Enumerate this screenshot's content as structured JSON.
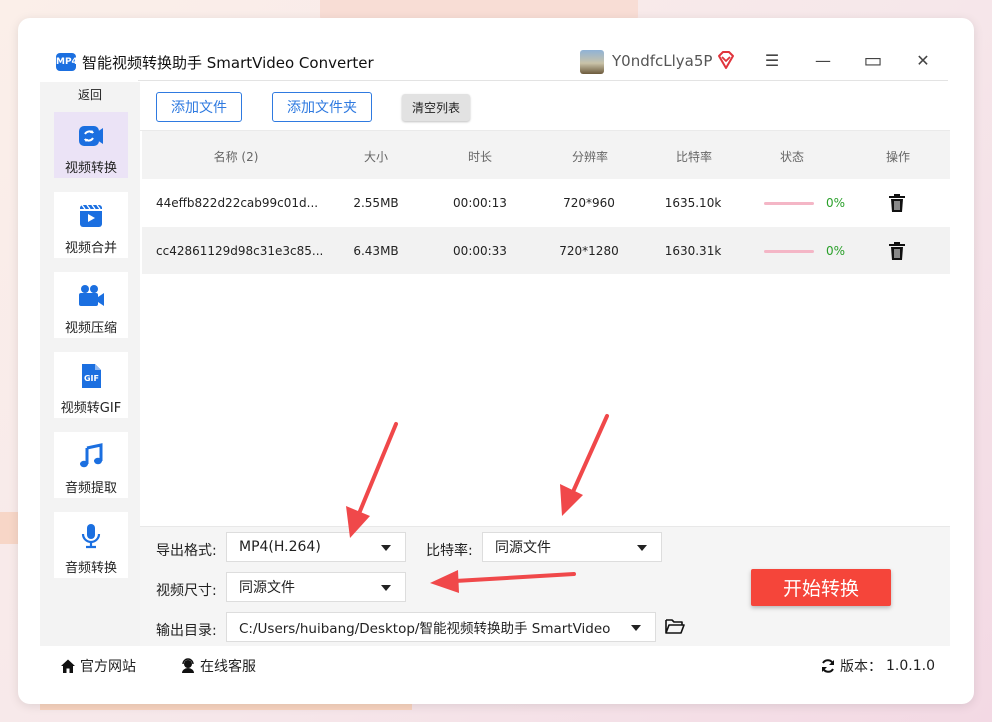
{
  "window": {
    "title": "智能视频转换助手 SmartVideo Converter",
    "logo_text": "MP4",
    "username": "Y0ndfcLlya5P",
    "controls": {
      "menu": "☰",
      "minimize": "—",
      "maximize": "▭",
      "close": "✕"
    }
  },
  "sidebar": {
    "back_label": "返回",
    "items": [
      {
        "label": "视频转换",
        "icon": "video-convert-icon",
        "active": true
      },
      {
        "label": "视频合并",
        "icon": "video-merge-icon",
        "active": false
      },
      {
        "label": "视频压缩",
        "icon": "video-compress-icon",
        "active": false
      },
      {
        "label": "视频转GIF",
        "icon": "gif-icon",
        "active": false
      },
      {
        "label": "音频提取",
        "icon": "music-note-icon",
        "active": false
      },
      {
        "label": "音频转换",
        "icon": "microphone-icon",
        "active": false
      }
    ]
  },
  "toolbar": {
    "add_file": "添加文件",
    "add_folder": "添加文件夹",
    "clear_list": "清空列表"
  },
  "table": {
    "headers": [
      "名称 (2)",
      "大小",
      "时长",
      "分辨率",
      "比特率",
      "状态",
      "操作"
    ],
    "rows": [
      {
        "name": "44effb822d22cab99c01d...",
        "size": "2.55MB",
        "duration": "00:00:13",
        "resolution": "720*960",
        "bitrate": "1635.10k",
        "progress": "0%"
      },
      {
        "name": "cc42861129d98c31e3c85...",
        "size": "6.43MB",
        "duration": "00:00:33",
        "resolution": "720*1280",
        "bitrate": "1630.31k",
        "progress": "0%"
      }
    ]
  },
  "options": {
    "format_label": "导出格式:",
    "format_value": "MP4(H.264)",
    "bitrate_label": "比特率:",
    "bitrate_value": "同源文件",
    "size_label": "视频尺寸:",
    "size_value": "同源文件",
    "output_label": "输出目录:",
    "output_value": "C:/Users/huibang/Desktop/智能视频转换助手 SmartVideo",
    "start_button": "开始转换"
  },
  "footer": {
    "website": "官方网站",
    "support": "在线客服",
    "version_label": "版本：",
    "version": "1.0.1.0"
  },
  "colors": {
    "accent": "#2f7ae0",
    "start": "#f5453a",
    "annotation": "#f0484a",
    "progress_text": "#2aa02a"
  }
}
